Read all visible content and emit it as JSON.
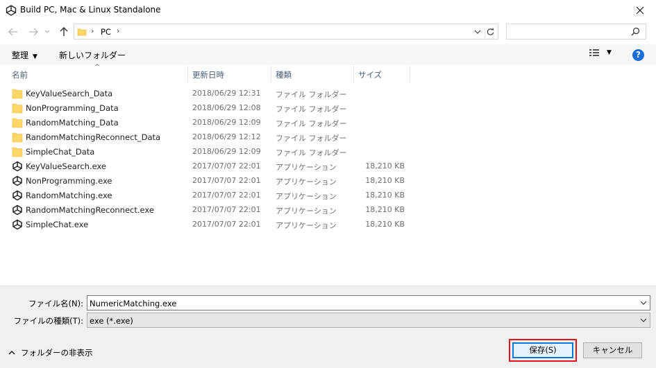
{
  "window": {
    "title": "Build PC, Mac & Linux Standalone"
  },
  "nav": {
    "breadcrumb": "PC",
    "search_placeholder": ""
  },
  "toolbar": {
    "organize_label": "整理",
    "new_folder_label": "新しいフォルダー"
  },
  "columns": {
    "name": "名前",
    "date": "更新日時",
    "type": "種類",
    "size": "サイズ"
  },
  "files": [
    {
      "name": "KeyValueSearch_Data",
      "date": "2018/06/29 12:31",
      "type": "ファイル フォルダー",
      "size": "",
      "icon": "folder-icon"
    },
    {
      "name": "NonProgramming_Data",
      "date": "2018/06/29 12:08",
      "type": "ファイル フォルダー",
      "size": "",
      "icon": "folder-icon"
    },
    {
      "name": "RandomMatching_Data",
      "date": "2018/06/29 12:09",
      "type": "ファイル フォルダー",
      "size": "",
      "icon": "folder-icon"
    },
    {
      "name": "RandomMatchingReconnect_Data",
      "date": "2018/06/29 12:12",
      "type": "ファイル フォルダー",
      "size": "",
      "icon": "folder-icon"
    },
    {
      "name": "SimpleChat_Data",
      "date": "2018/06/29 12:09",
      "type": "ファイル フォルダー",
      "size": "",
      "icon": "folder-icon"
    },
    {
      "name": "KeyValueSearch.exe",
      "date": "2017/07/07 22:01",
      "type": "アプリケーション",
      "size": "18,210 KB",
      "icon": "unity-icon"
    },
    {
      "name": "NonProgramming.exe",
      "date": "2017/07/07 22:01",
      "type": "アプリケーション",
      "size": "18,210 KB",
      "icon": "unity-icon"
    },
    {
      "name": "RandomMatching.exe",
      "date": "2017/07/07 22:01",
      "type": "アプリケーション",
      "size": "18,210 KB",
      "icon": "unity-icon"
    },
    {
      "name": "RandomMatchingReconnect.exe",
      "date": "2017/07/07 22:01",
      "type": "アプリケーション",
      "size": "18,210 KB",
      "icon": "unity-icon"
    },
    {
      "name": "SimpleChat.exe",
      "date": "2017/07/07 22:01",
      "type": "アプリケーション",
      "size": "18,210 KB",
      "icon": "unity-icon"
    }
  ],
  "form": {
    "filename_label": "ファイル名(N):",
    "filename_value": "NumericMatching.exe",
    "filetype_label": "ファイルの種類(T):",
    "filetype_value": "exe (*.exe)"
  },
  "footer": {
    "hide_folders_label": "フォルダーの非表示",
    "save_label": "保存(S)",
    "cancel_label": "キャンセル"
  },
  "colors": {
    "accent": "#0078d7",
    "highlight_outline": "#e81123",
    "help_blue": "#1a6ed8",
    "folder_yellow": "#ffd767"
  }
}
